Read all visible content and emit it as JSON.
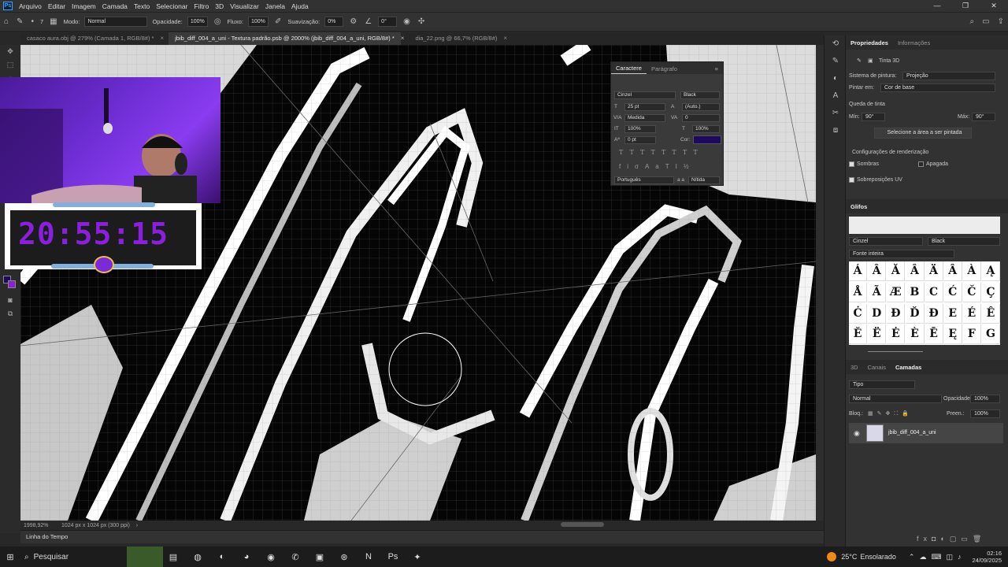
{
  "menu": {
    "items": [
      "Arquivo",
      "Editar",
      "Imagem",
      "Camada",
      "Texto",
      "Selecionar",
      "Filtro",
      "3D",
      "Visualizar",
      "Janela",
      "Ajuda"
    ]
  },
  "options": {
    "mode_label": "Modo:",
    "mode_value": "Normal",
    "opacity_label": "Opacidade:",
    "opacity_value": "100%",
    "flow_label": "Fluxo:",
    "flow_value": "100%",
    "smooth_label": "Suavização:",
    "smooth_value": "0%",
    "angle_value": "0°",
    "brush_size": "7"
  },
  "tabs": [
    {
      "label": "casaco aura.obj @ 279% (Camada 1, RGB/8#) *",
      "active": false
    },
    {
      "label": "jbib_diff_004_a_uni - Textura padrão.psb @ 2000% (jbib_diff_004_a_uni, RGB/8#) *",
      "active": true
    },
    {
      "label": "dia_22.png @ 66,7% (RGB/8#)",
      "active": false
    }
  ],
  "clock": {
    "time": "20:55:15"
  },
  "character": {
    "tab1": "Caractere",
    "tab2": "Parágrafo",
    "font": "Cinzel",
    "style": "Black",
    "size": "25 pt",
    "leading": "(Auto.)",
    "kerning": "Medida",
    "tracking": "0",
    "vscale": "100%",
    "hscale": "100%",
    "baseline": "0 pt",
    "color_label": "Cor:",
    "color": "#1e0a5c",
    "language": "Português",
    "antialias": "Nítida",
    "aa_label": "a a"
  },
  "properties": {
    "tab1": "Propriedades",
    "tab2": "Informações",
    "title": "Tinta 3D",
    "system_label": "Sistema de pintura:",
    "system_value": "Projeção",
    "paint_label": "Pintar em:",
    "paint_value": "Cor de base",
    "falloff": "Queda de tinta",
    "min_label": "Mín:",
    "min_value": "90°",
    "max_label": "Máx:",
    "max_value": "90°",
    "select_btn": "Selecione a área a ser pintada",
    "render_label": "Configurações de renderização",
    "shadows": "Sombras",
    "erased": "Apagada",
    "uv": "Sobreposições UV"
  },
  "glyphs": {
    "tab": "Glifos",
    "font": "Cinzel",
    "style": "Black",
    "filter": "Fonte inteira",
    "chars": [
      "Á",
      "Â",
      "Ă",
      "Â",
      "Ä",
      "Â",
      "À",
      "Ą",
      "Å",
      "Ã",
      "Æ",
      "B",
      "C",
      "Ć",
      "Č",
      "Ç",
      "Ċ",
      "D",
      "Đ",
      "Ď",
      "Ð",
      "E",
      "É",
      "Ê",
      "Ě",
      "Ë",
      "Ė",
      "È",
      "Ē",
      "Ę",
      "F",
      "G"
    ]
  },
  "layers": {
    "tabs": [
      "3D",
      "Canais",
      "Camadas"
    ],
    "kind": "Tipo",
    "blend": "Normal",
    "opacity_label": "Opacidade:",
    "opacity": "100%",
    "lock_label": "Bloq.:",
    "fill_label": "Preen.:",
    "fill": "100%",
    "layer_name": "jbib_diff_004_a_uni"
  },
  "status": {
    "zoom": "1998,92%",
    "info": "1024 px x 1024 px (300 ppi)"
  },
  "timeline": {
    "label": "Linha do Tempo"
  },
  "taskbar": {
    "search": "Pesquisar",
    "weather_temp": "25°C",
    "weather_desc": "Ensolarado",
    "time": "02:16",
    "date": "24/09/2025"
  }
}
